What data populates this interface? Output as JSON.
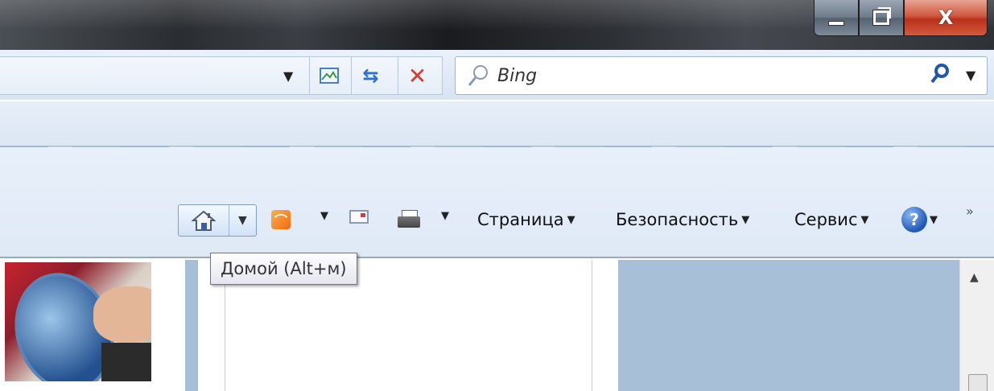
{
  "window": {
    "controls": {
      "minimize_icon": "minimize-icon",
      "maximize_icon": "restore-icon",
      "close_glyph": "X"
    }
  },
  "address_bar": {
    "dropdown_glyph": "▼",
    "compat_icon": "compatibility-view-icon",
    "refresh_glyph": "⇆",
    "stop_glyph": "✕"
  },
  "search": {
    "placeholder": "Bing",
    "search_icon": "search-icon",
    "dropdown_glyph": "▼"
  },
  "command_bar": {
    "home_icon": "home-icon",
    "feeds_icon": "rss-feed-icon",
    "mail_icon": "read-mail-icon",
    "print_icon": "printer-icon",
    "caret": "▼",
    "page_label": "Страница",
    "safety_label": "Безопасность",
    "tools_label": "Сервис",
    "help_glyph": "?",
    "more_glyph": "»"
  },
  "tooltip": {
    "text": "Домой (Alt+м)"
  },
  "scrollbar": {
    "up_glyph": "▲"
  }
}
